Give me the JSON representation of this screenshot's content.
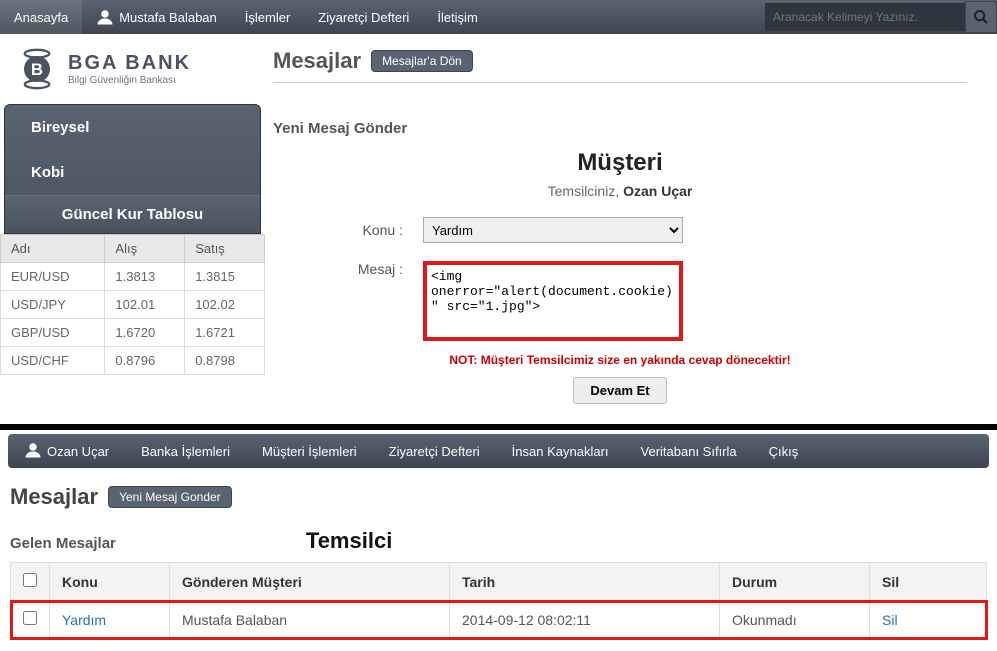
{
  "topnav": {
    "items": [
      "Anasayfa",
      "Mustafa Balaban",
      "İşlemler",
      "Ziyaretçi Defteri",
      "İletişim"
    ],
    "search_placeholder": "Aranacak Kelimeyi Yazınız."
  },
  "logo": {
    "title": "BGA BANK",
    "sub": "Bilgi Güvenliğin Bankası"
  },
  "page": {
    "title": "Mesajlar",
    "back_btn": "Mesajlar'a Dön"
  },
  "sidebar": {
    "items": [
      "Bireysel",
      "Kobi"
    ],
    "rate_heading": "Güncel Kur Tablosu",
    "headers": [
      "Adı",
      "Alış",
      "Satış"
    ],
    "rates": [
      {
        "name": "EUR/USD",
        "buy": "1.3813",
        "sell": "1.3815"
      },
      {
        "name": "USD/JPY",
        "buy": "102.01",
        "sell": "102.02"
      },
      {
        "name": "GBP/USD",
        "buy": "1.6720",
        "sell": "1.6721"
      },
      {
        "name": "USD/CHF",
        "buy": "0.8796",
        "sell": "0.8798"
      }
    ]
  },
  "form": {
    "title": "Yeni Mesaj Gönder",
    "musteri": "Müşteri",
    "rep_label": "Temsilciniz,",
    "rep_name": "Ozan Uçar",
    "konu_label": "Konu :",
    "konu_value": "Yardım",
    "mesaj_label": "Mesaj :",
    "mesaj_value": "<img onerror=\"alert(document.cookie)\" src=\"1.jpg\">",
    "note_prefix": "NOT:",
    "note_text": " Müşteri Temsilcimiz size en yakında cevap dönecektir!",
    "submit": "Devam Et"
  },
  "nav2": {
    "items": [
      "Ozan Uçar",
      "Banka İşlemleri",
      "Müşteri İşlemleri",
      "Ziyaretçi Defteri",
      "İnsan Kaynakları",
      "Veritabanı Sıfırla",
      "Çıkış"
    ]
  },
  "bottom": {
    "title": "Mesajlar",
    "new_btn": "Yeni Mesaj Gonder",
    "inbox_title": "Gelen Mesajlar",
    "temsilci": "Temsilci",
    "headers": [
      "",
      "Konu",
      "Gönderen Müşteri",
      "Tarih",
      "Durum",
      "Sil"
    ],
    "rows": [
      {
        "konu": "Yardım",
        "gonderen": "Mustafa Balaban",
        "tarih": "2014-09-12 08:02:11",
        "durum": "Okunmadı",
        "sil": "Sil"
      }
    ]
  }
}
